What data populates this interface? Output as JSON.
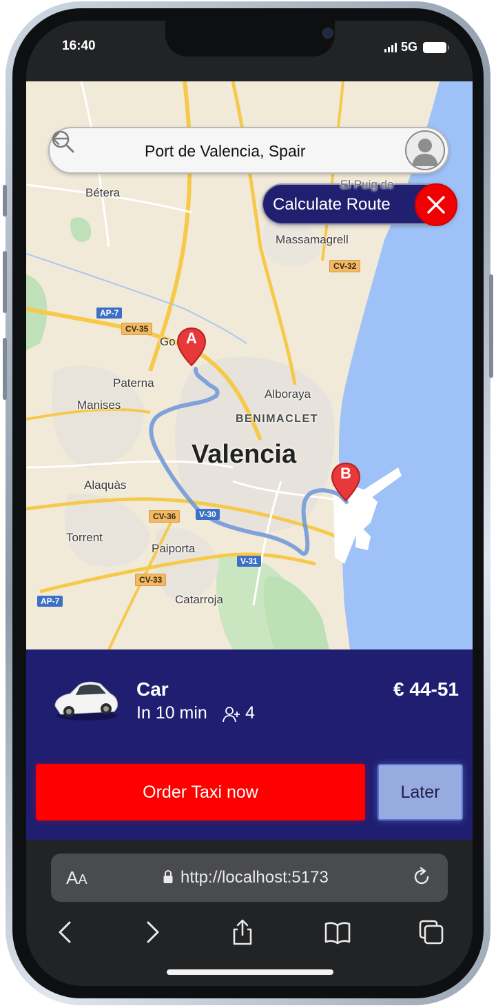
{
  "status_bar": {
    "time": "16:40",
    "network": "5G"
  },
  "search": {
    "value": "Port de Valencia, Spair",
    "placeholder": ""
  },
  "route_control": {
    "label": "Calculate Route"
  },
  "map": {
    "labels": {
      "betera": "Bétera",
      "el_puig": "El Puig de",
      "massamagrell": "Massamagrell",
      "godella": "Go",
      "paterna": "Paterna",
      "manises": "Manises",
      "alboraya": "Alboraya",
      "benimaclet": "BENIMACLET",
      "valencia": "Valencia",
      "alaquas": "Alaquàs",
      "torrent": "Torrent",
      "paiporta": "Paiporta",
      "catarroja": "Catarroja"
    },
    "shields": {
      "ap7_north": "AP-7",
      "cv35": "CV-35",
      "cv32": "CV-32",
      "cv36": "CV-36",
      "v30": "V-30",
      "v31": "V-31",
      "cv33": "CV-33",
      "ap7_south": "AP-7"
    },
    "markers": {
      "start": "A",
      "end": "B"
    },
    "route_color": "#6d95d8"
  },
  "ride": {
    "vehicle": "Car",
    "eta": "In 10 min",
    "seats": "4",
    "price": "€ 44-51",
    "order_label": "Order Taxi now",
    "later_label": "Later"
  },
  "browser": {
    "text_size_label": "A",
    "text_size_label_small": "A",
    "url": "http://localhost:5173"
  },
  "colors": {
    "sheet": "#1f1e71",
    "order": "#ff0000",
    "later": "#98abe1",
    "water": "#9ec1f7"
  }
}
